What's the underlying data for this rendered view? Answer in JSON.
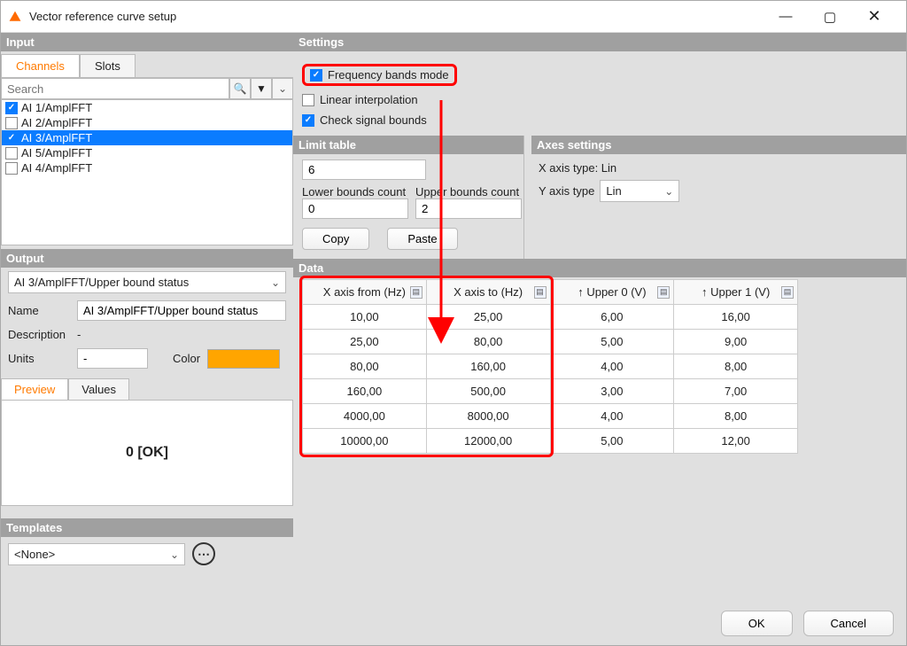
{
  "window": {
    "title": "Vector reference curve setup"
  },
  "input": {
    "header": "Input",
    "tabs": {
      "channels": "Channels",
      "slots": "Slots"
    },
    "search_placeholder": "Search",
    "channels": [
      {
        "label": "AI 1/AmplFFT",
        "checked": true,
        "selected": false
      },
      {
        "label": "AI 2/AmplFFT",
        "checked": false,
        "selected": false
      },
      {
        "label": "AI 3/AmplFFT",
        "checked": true,
        "selected": true
      },
      {
        "label": "AI 5/AmplFFT",
        "checked": false,
        "selected": false
      },
      {
        "label": "AI 4/AmplFFT",
        "checked": false,
        "selected": false
      }
    ]
  },
  "output": {
    "header": "Output",
    "select_value": "AI 3/AmplFFT/Upper bound status",
    "name_label": "Name",
    "name_value": "AI 3/AmplFFT/Upper bound status",
    "description_label": "Description",
    "description_value": "-",
    "units_label": "Units",
    "units_value": "-",
    "color_label": "Color",
    "tabs": {
      "preview": "Preview",
      "values": "Values"
    },
    "preview_text": "0 [OK]"
  },
  "templates": {
    "header": "Templates",
    "select_value": "<None>"
  },
  "settings": {
    "header": "Settings",
    "freq_bands_label": "Frequency bands mode",
    "freq_bands_checked": true,
    "linear_label": "Linear interpolation",
    "linear_checked": false,
    "check_bounds_label": "Check signal bounds",
    "check_bounds_checked": true,
    "limit_table_header": "Limit table",
    "limit_value": "6",
    "lower_label": "Lower bounds count",
    "lower_value": "0",
    "upper_label": "Upper bounds count",
    "upper_value": "2",
    "copy": "Copy",
    "paste": "Paste",
    "axes_header": "Axes settings",
    "xaxis_label": "X axis type: Lin",
    "yaxis_label": "Y axis type",
    "yaxis_value": "Lin"
  },
  "data": {
    "header": "Data",
    "columns": [
      "X axis from (Hz)",
      "X axis to (Hz)",
      "↑ Upper 0 (V)",
      "↑ Upper 1 (V)"
    ],
    "rows": [
      [
        "10,00",
        "25,00",
        "6,00",
        "16,00"
      ],
      [
        "25,00",
        "80,00",
        "5,00",
        "9,00"
      ],
      [
        "80,00",
        "160,00",
        "4,00",
        "8,00"
      ],
      [
        "160,00",
        "500,00",
        "3,00",
        "7,00"
      ],
      [
        "4000,00",
        "8000,00",
        "4,00",
        "8,00"
      ],
      [
        "10000,00",
        "12000,00",
        "5,00",
        "12,00"
      ]
    ]
  },
  "footer": {
    "ok": "OK",
    "cancel": "Cancel"
  },
  "chart_data": {
    "type": "table",
    "title": "Limit table (frequency bands, upper bounds)",
    "columns": [
      "X axis from (Hz)",
      "X axis to (Hz)",
      "Upper 0 (V)",
      "Upper 1 (V)"
    ],
    "rows": [
      [
        10,
        25,
        6,
        16
      ],
      [
        25,
        80,
        5,
        9
      ],
      [
        80,
        160,
        4,
        8
      ],
      [
        160,
        500,
        3,
        7
      ],
      [
        4000,
        8000,
        4,
        8
      ],
      [
        10000,
        12000,
        5,
        12
      ]
    ],
    "x_axis_type": "Lin",
    "y_axis_type": "Lin"
  }
}
